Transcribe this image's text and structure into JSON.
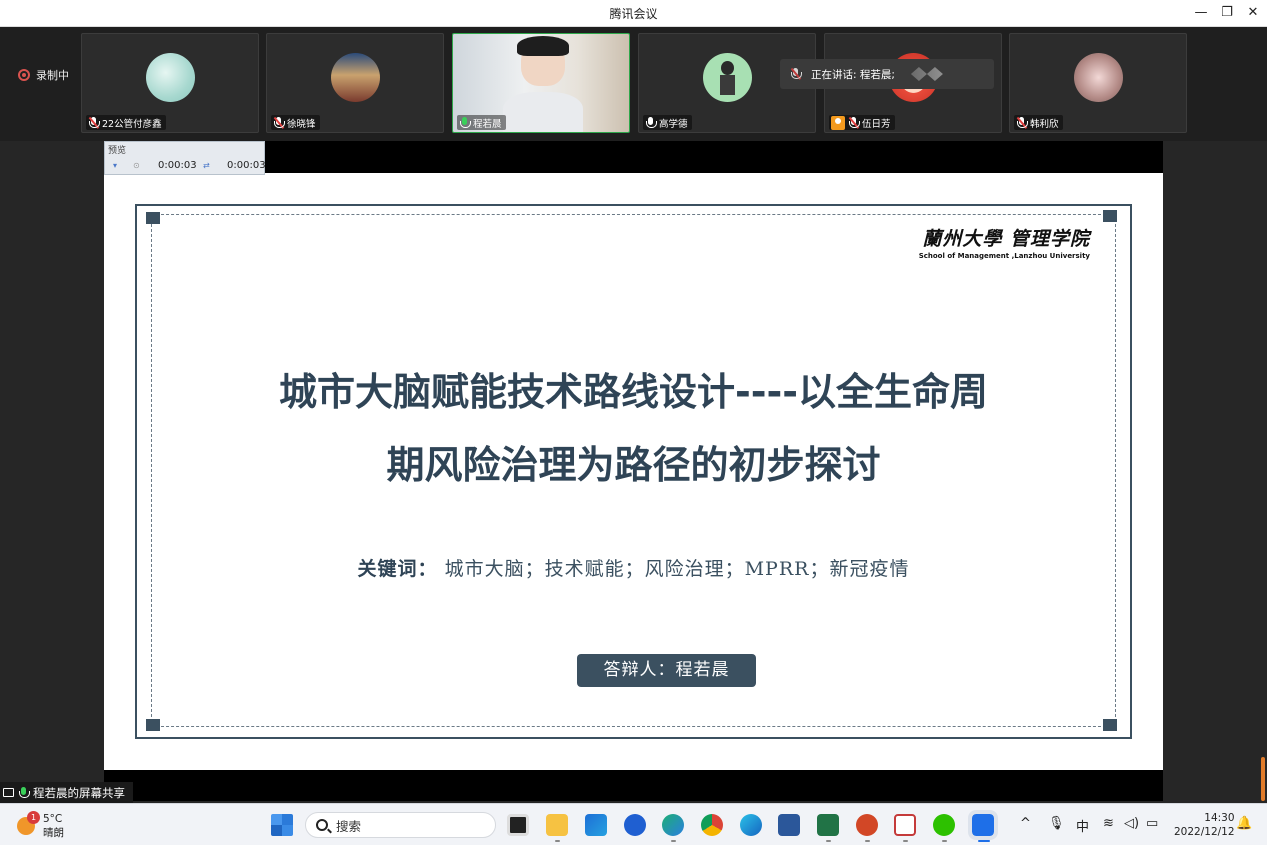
{
  "window": {
    "title": "腾讯会议"
  },
  "recording": {
    "label": "录制中"
  },
  "participants": [
    {
      "name": "22公管付彦鑫"
    },
    {
      "name": "徐晓锋"
    },
    {
      "name": "程若晨"
    },
    {
      "name": "高学德"
    },
    {
      "name": "伍日芳"
    },
    {
      "name": "韩利欣"
    }
  ],
  "speaking": {
    "label": "正在讲话: 程若晨;"
  },
  "preview": {
    "label": "预览",
    "time_start": "0:00:03",
    "time_end": "0:00:03"
  },
  "slide": {
    "logo_cn": "蘭州大學 管理学院",
    "logo_en": "School of Management ,Lanzhou University",
    "title_line1": "城市大脑赋能技术路线设计----以全生命周",
    "title_line2": "期风险治理为路径的初步探讨",
    "keywords_label": "关键词：",
    "keywords": "城市大脑；技术赋能；风险治理；MPRR；新冠疫情",
    "presenter": "答辩人：程若晨"
  },
  "share_bar": {
    "label": "程若晨的屏幕共享"
  },
  "taskbar": {
    "weather_temp": "5°C",
    "weather_desc": "晴朗",
    "weather_badge": "1",
    "search_label": "搜索",
    "ime": "中",
    "time": "14:30",
    "date": "2022/12/12"
  },
  "colors": {
    "slide_accent": "#3b5060",
    "title_color": "#2f4456",
    "record_red": "#d9534f",
    "active_green": "#2ea84b"
  }
}
